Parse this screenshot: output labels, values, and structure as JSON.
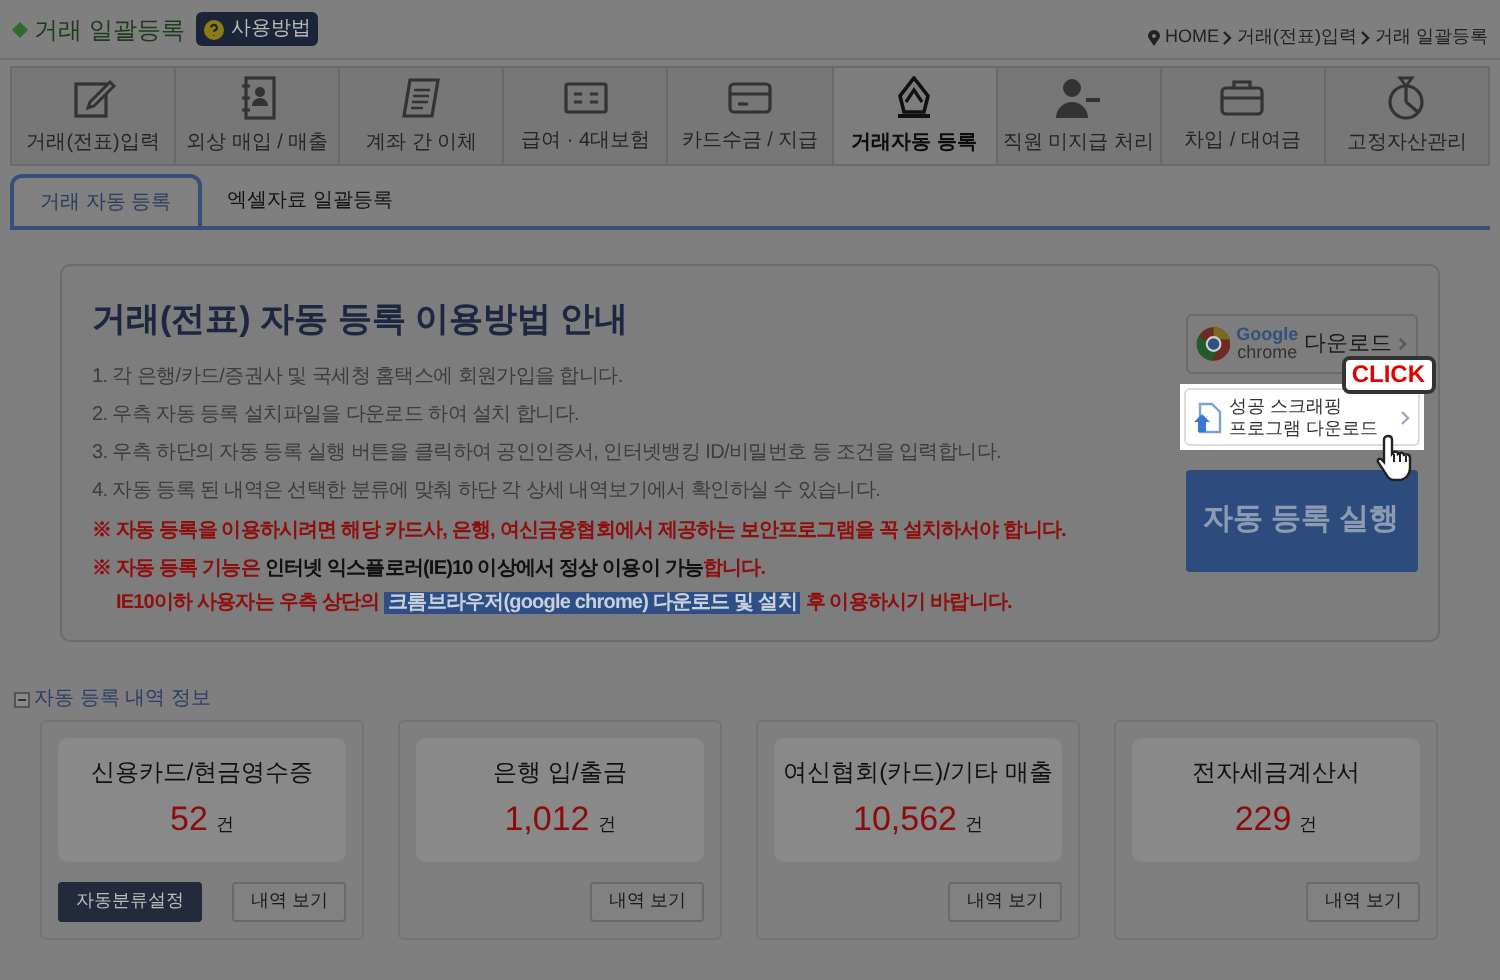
{
  "header": {
    "title": "거래 일괄등록",
    "help_button": "사용방법",
    "breadcrumb": [
      "HOME",
      "거래(전표)입력",
      "거래 일괄등록"
    ]
  },
  "nav": [
    {
      "label": "거래(전표)입력",
      "selected": false
    },
    {
      "label": "외상 매입 / 매출",
      "selected": false
    },
    {
      "label": "계좌 간 이체",
      "selected": false
    },
    {
      "label": "급여 · 4대보험",
      "selected": false
    },
    {
      "label": "카드수금 / 지급",
      "selected": false
    },
    {
      "label": "거래자동 등록",
      "selected": true
    },
    {
      "label": "직원 미지급 처리",
      "selected": false
    },
    {
      "label": "차입 / 대여금",
      "selected": false
    },
    {
      "label": "고정자산관리",
      "selected": false
    }
  ],
  "subtabs": [
    {
      "label": "거래 자동 등록",
      "selected": true
    },
    {
      "label": "엑셀자료 일괄등록",
      "selected": false
    }
  ],
  "guide": {
    "title": "거래(전표) 자동 등록 이용방법 안내",
    "steps": [
      "1. 각 은행/카드/증권사 및 국세청 홈택스에 회원가입을 합니다.",
      "2. 우측 자동 등록 설치파일을 다운로드 하여 설치 합니다.",
      "3. 우측 하단의 자동 등록 실행 버튼을 클릭하여 공인인증서, 인터넷뱅킹 ID/비밀번호 등 조건을 입력합니다.",
      "4. 자동 등록 된 내역은 선택한 분류에 맞춰 하단 각 상세 내역보기에서 확인하실 수 있습니다."
    ],
    "notices": [
      [
        {
          "kind": "red",
          "text": "※ 자동 등록을 이용하시려면 해당 카드사, 은행, 여신금융협회에서 제공하는 보안프로그램을 꼭 설치하서야 합니다."
        }
      ],
      [
        {
          "kind": "red",
          "text": "※ 자동 등록 기능은 "
        },
        {
          "kind": "dark",
          "text": "인터넷 익스플로러(IE)10 이상에서 정상 이용이 가능"
        },
        {
          "kind": "red",
          "text": "합니다."
        }
      ],
      [
        {
          "kind": "red",
          "text": "IE10이하 사용자는 우측 상단의 "
        },
        {
          "kind": "highlight",
          "text": "크롬브라우저(google chrome) 다운로드 및 설치"
        },
        {
          "kind": "red",
          "text": " 후 이용하시기 바랍니다."
        }
      ]
    ],
    "chrome_button": {
      "logo_top": "Google",
      "logo_bottom": "chrome",
      "label": "다운로드"
    },
    "scraping_button": {
      "line_1": "성공 스크래핑",
      "line_2": "프로그램 다운로드"
    },
    "click_callout": "CLICK",
    "run_button": "자동 등록 실행"
  },
  "summary": {
    "title": "자동 등록 내역 정보",
    "cards": [
      {
        "title": "신용카드/현금영수증",
        "count": "52",
        "unit": "건",
        "buttons": [
          {
            "kind": "dark",
            "label": "자동분류설정"
          },
          {
            "kind": "light",
            "label": "내역 보기"
          }
        ]
      },
      {
        "title": "은행 입/출금",
        "count": "1,012",
        "unit": "건",
        "buttons": [
          {
            "kind": "light",
            "label": "내역 보기"
          }
        ]
      },
      {
        "title": "여신협회(카드)/기타 매출",
        "count": "10,562",
        "unit": "건",
        "buttons": [
          {
            "kind": "light",
            "label": "내역 보기"
          }
        ]
      },
      {
        "title": "전자세금계산서",
        "count": "229",
        "unit": "건",
        "buttons": [
          {
            "kind": "light",
            "label": "내역 보기"
          }
        ]
      }
    ]
  }
}
